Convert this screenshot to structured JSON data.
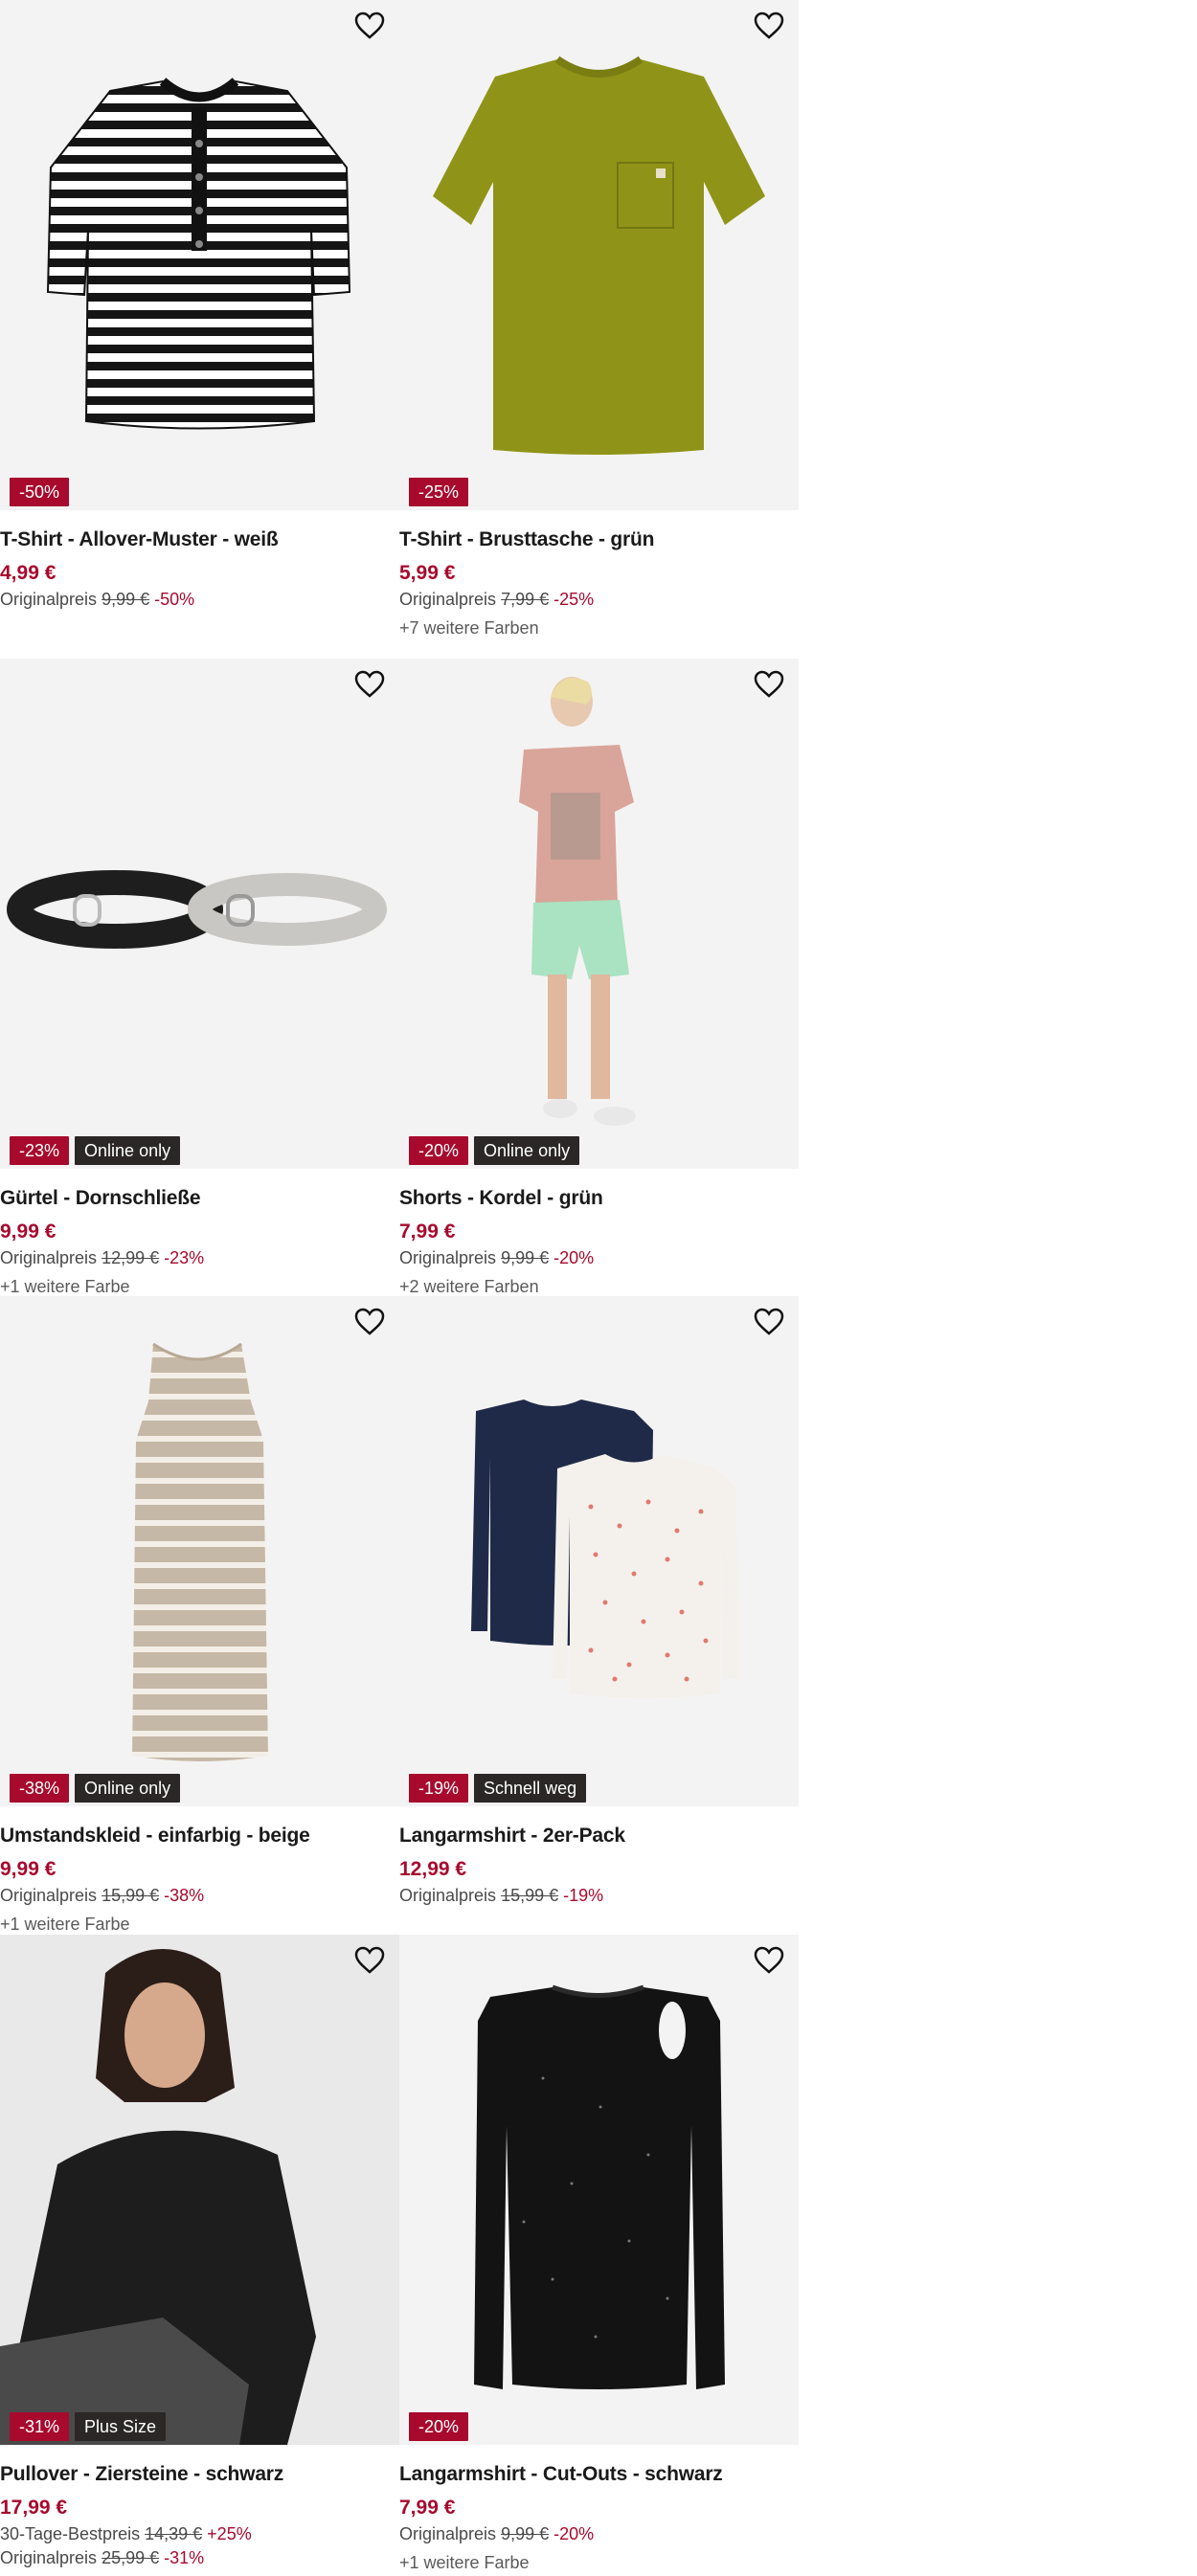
{
  "colors": {
    "sale_red": "#a70a2d",
    "badge_dark": "#2b2727"
  },
  "products": [
    {
      "title": "T-Shirt - Allover-Muster - weiß",
      "price": "4,99 €",
      "original_label": "Originalpreis",
      "original_price": "9,99 €",
      "original_pct": "-50%",
      "badges": [
        "-50%"
      ],
      "wishlist_icon": "heart-outline-icon"
    },
    {
      "title": "T-Shirt - Brusttasche - grün",
      "price": "5,99 €",
      "original_label": "Originalpreis",
      "original_price": "7,99 €",
      "original_pct": "-25%",
      "more_colors": "+7 weitere Farben",
      "badges": [
        "-25%"
      ],
      "wishlist_icon": "heart-outline-icon"
    },
    {
      "title": "Gürtel - Dornschließe",
      "price": "9,99 €",
      "original_label": "Originalpreis",
      "original_price": "12,99 €",
      "original_pct": "-23%",
      "more_colors": "+1 weitere Farbe",
      "badges": [
        "-23%",
        "Online only"
      ],
      "wishlist_icon": "heart-outline-icon"
    },
    {
      "title": "Shorts - Kordel - grün",
      "price": "7,99 €",
      "original_label": "Originalpreis",
      "original_price": "9,99 €",
      "original_pct": "-20%",
      "more_colors": "+2 weitere Farben",
      "badges": [
        "-20%",
        "Online only"
      ],
      "wishlist_icon": "heart-outline-icon"
    },
    {
      "title": "Umstandskleid - einfarbig - beige",
      "price": "9,99 €",
      "original_label": "Originalpreis",
      "original_price": "15,99 €",
      "original_pct": "-38%",
      "more_colors": "+1 weitere Farbe",
      "badges": [
        "-38%",
        "Online only"
      ],
      "wishlist_icon": "heart-outline-icon"
    },
    {
      "title": "Langarmshirt - 2er-Pack",
      "price": "12,99 €",
      "original_label": "Originalpreis",
      "original_price": "15,99 €",
      "original_pct": "-19%",
      "badges": [
        "-19%",
        "Schnell weg"
      ],
      "wishlist_icon": "heart-outline-icon"
    },
    {
      "title": "Pullover - Ziersteine - schwarz",
      "price": "17,99 €",
      "prior_label": "30-Tage-Bestpreis",
      "prior_price": "14,39 €",
      "prior_pct": "+25%",
      "original_label": "Originalpreis",
      "original_price": "25,99 €",
      "original_pct": "-31%",
      "badges": [
        "-31%",
        "Plus Size"
      ],
      "wishlist_icon": "heart-outline-icon"
    },
    {
      "title": "Langarmshirt - Cut-Outs - schwarz",
      "price": "7,99 €",
      "original_label": "Originalpreis",
      "original_price": "9,99 €",
      "original_pct": "-20%",
      "more_colors": "+1 weitere Farbe",
      "badges": [
        "-20%"
      ],
      "wishlist_icon": "heart-outline-icon"
    }
  ]
}
